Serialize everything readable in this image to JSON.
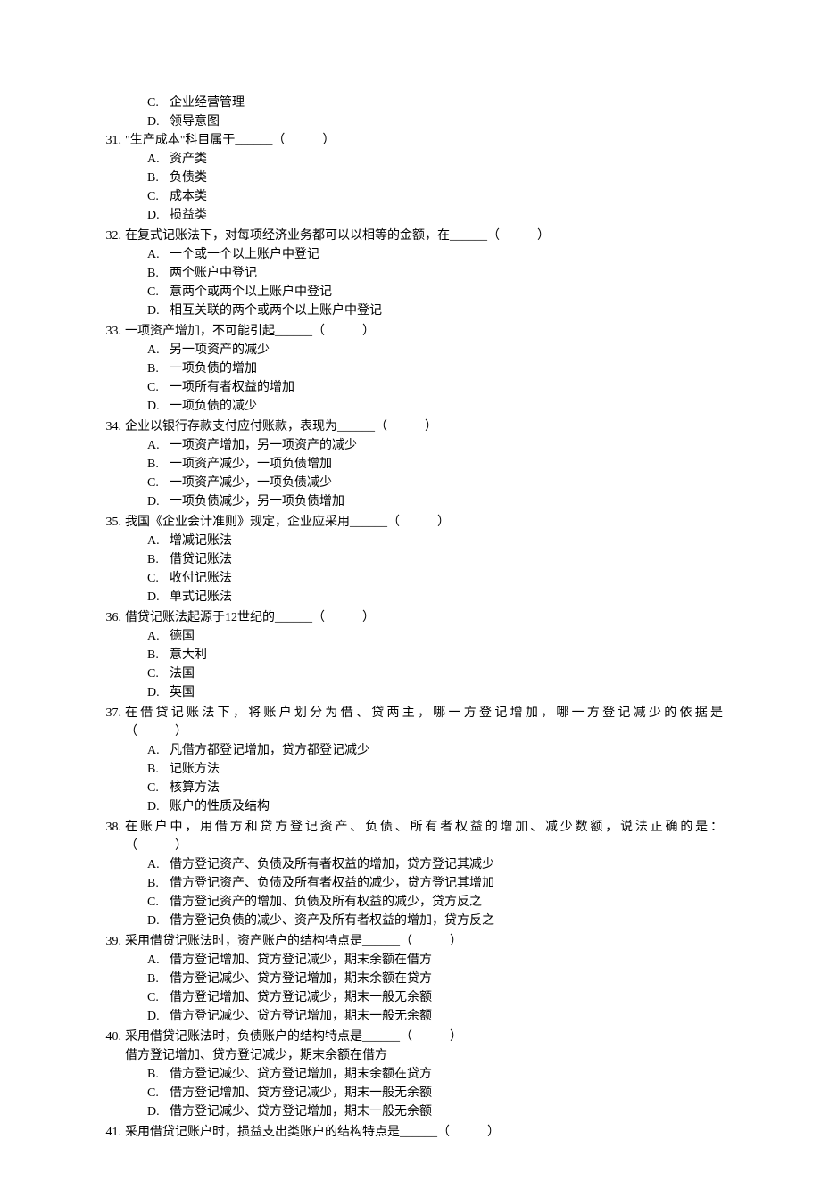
{
  "orphan_options": [
    {
      "letter": "C.",
      "text": "企业经营管理"
    },
    {
      "letter": "D.",
      "text": "领导意图"
    }
  ],
  "questions": [
    {
      "num": "31.",
      "stem": "\"生产成本\"科目属于______（　　　）",
      "options": [
        {
          "letter": "A.",
          "text": "资产类"
        },
        {
          "letter": "B.",
          "text": "负债类"
        },
        {
          "letter": "C.",
          "text": "成本类"
        },
        {
          "letter": "D.",
          "text": "损益类"
        }
      ]
    },
    {
      "num": "32.",
      "stem": "在复式记账法下，对每项经济业务都可以以相等的金额，在______（　　　）",
      "options": [
        {
          "letter": "A.",
          "text": "一个或一个以上账户中登记"
        },
        {
          "letter": "B.",
          "text": "两个账户中登记"
        },
        {
          "letter": "C.",
          "text": "意两个或两个以上账户中登记"
        },
        {
          "letter": "D.",
          "text": "相互关联的两个或两个以上账户中登记"
        }
      ]
    },
    {
      "num": "33.",
      "stem": "一项资产增加，不可能引起______（　　　）",
      "options": [
        {
          "letter": "A.",
          "text": "另一项资产的减少"
        },
        {
          "letter": "B.",
          "text": "一项负债的增加"
        },
        {
          "letter": "C.",
          "text": "一项所有者权益的增加"
        },
        {
          "letter": "D.",
          "text": "一项负债的减少"
        }
      ]
    },
    {
      "num": "34.",
      "stem": "企业以银行存款支付应付账款，表现为______（　　　）",
      "options": [
        {
          "letter": "A.",
          "text": "一项资产增加，另一项资产的减少"
        },
        {
          "letter": "B.",
          "text": "一项资产减少，一项负债增加"
        },
        {
          "letter": "C.",
          "text": "一项资产减少，一项负债减少"
        },
        {
          "letter": "D.",
          "text": "一项负债减少，另一项负债增加"
        }
      ]
    },
    {
      "num": "35.",
      "stem": "我国《企业会计准则》规定，企业应采用______（　　　）",
      "options": [
        {
          "letter": "A.",
          "text": "增减记账法"
        },
        {
          "letter": "B.",
          "text": "借贷记账法"
        },
        {
          "letter": "C.",
          "text": "收付记账法"
        },
        {
          "letter": "D.",
          "text": "单式记账法"
        }
      ]
    },
    {
      "num": "36.",
      "stem": "借贷记账法起源于12世纪的______（　　　）",
      "options": [
        {
          "letter": "A.",
          "text": "德国"
        },
        {
          "letter": "B.",
          "text": "意大利"
        },
        {
          "letter": "C.",
          "text": "法国"
        },
        {
          "letter": "D.",
          "text": "英国"
        }
      ]
    },
    {
      "num": "37.",
      "stem_spread": true,
      "stem": "在借贷记账法下，将账户划分为借、贷两主，哪一方登记增加，哪一方登记减少的依据是",
      "stem_line2": "（　　　）",
      "options": [
        {
          "letter": "A.",
          "text": "凡借方都登记增加，贷方都登记减少"
        },
        {
          "letter": "B.",
          "text": "记账方法"
        },
        {
          "letter": "C.",
          "text": "核算方法"
        },
        {
          "letter": "D.",
          "text": "账户的性质及结构"
        }
      ]
    },
    {
      "num": "38.",
      "stem_spread": true,
      "stem": "在账户中，用借方和贷方登记资产、负债、所有者权益的增加、减少数额，说法正确的是：",
      "stem_line2": "（　　　）",
      "options": [
        {
          "letter": "A.",
          "text": "借方登记资产、负债及所有者权益的增加，贷方登记其减少"
        },
        {
          "letter": "B.",
          "text": "借方登记资产、负债及所有者权益的减少，贷方登记其增加"
        },
        {
          "letter": "C.",
          "text": "借方登记资产的增加、负债及所有权益的减少，贷方反之"
        },
        {
          "letter": "D.",
          "text": "借方登记负债的减少、资产及所有者权益的增加，贷方反之"
        }
      ]
    },
    {
      "num": "39.",
      "stem": "采用借贷记账法时，资产账户的结构特点是______（　　　）",
      "options": [
        {
          "letter": "A.",
          "text": "借方登记增加、贷方登记减少，期末余额在借方"
        },
        {
          "letter": "B.",
          "text": "借方登记减少、贷方登记增加，期末余额在贷方"
        },
        {
          "letter": "C.",
          "text": "借方登记增加、贷方登记减少，期末一般无余额"
        },
        {
          "letter": "D.",
          "text": "借方登记减少、贷方登记增加，期末一般无余额"
        }
      ]
    },
    {
      "num": "40.",
      "stem": "采用借贷记账法时，负债账户的结构特点是______（　　　）",
      "stem_line2_noletter": "借方登记增加、贷方登记减少，期末余额在借方",
      "options": [
        {
          "letter": "B.",
          "text": "借方登记减少、贷方登记增加，期末余额在贷方"
        },
        {
          "letter": "C.",
          "text": "借方登记增加、贷方登记减少，期末一般无余额"
        },
        {
          "letter": "D.",
          "text": "借方登记减少、贷方登记增加，期末一般无余额"
        }
      ]
    },
    {
      "num": "41.",
      "stem": "采用借贷记账户时，损益支出类账户的结构特点是______（　　　）",
      "options": []
    }
  ]
}
